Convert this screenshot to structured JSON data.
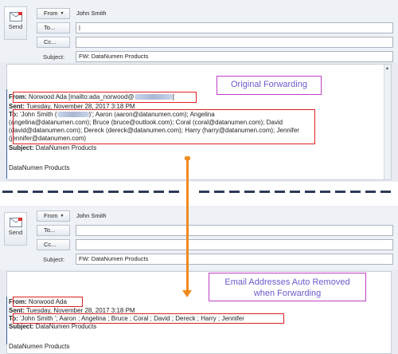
{
  "top": {
    "send_label": "Send",
    "from_label": "From",
    "sender_name": "John Smith",
    "to_label": "To...",
    "cc_label": "Cc...",
    "subject_label": "Subject:",
    "subject_value": "FW: DataNumen Products",
    "from_line_label": "From:",
    "from_line_value": "Norwood Ada [mailto:ada_norwood@",
    "from_line_tail": "]",
    "sent_label": "Sent:",
    "sent_value": "Tuesday, November 28, 2017 3:18 PM",
    "to_line_label": "To:",
    "to_line_1a": "'John Smith (",
    "to_line_1b": ")'; Aaron (aaron@datanumen.com); Angelina",
    "to_line_2": "(angelina@datanumen.com); Bruce (bruce@outlook.com); Coral (coral@datanumen.com); David",
    "to_line_3": "(david@datanumen.com); Dereck (dereck@datanumen.com); Harry (harry@datanumen.com); Jennifer",
    "to_line_4": "(jennifer@datanumen.com)",
    "subject_line_label": "Subject:",
    "subject_line_value": "DataNumen Products",
    "body_text": "DataNumen Products",
    "callout": "Original Forwarding"
  },
  "bottom": {
    "send_label": "Send",
    "from_label": "From",
    "sender_name": "John Smith",
    "to_label": "To...",
    "cc_label": "Cc...",
    "subject_label": "Subject:",
    "subject_value": "FW: DataNumen Products",
    "from_line_label": "From:",
    "from_line_value": "Norwood Ada",
    "sent_label": "Sent:",
    "sent_value": "Tuesday, November 28, 2017 3:18 PM",
    "to_line_label": "To:",
    "to_line_value": "'John Smith '; Aaron ; Angelina ; Bruce ; Coral ; David ; Dereck ; Harry ; Jennifer",
    "subject_line_label": "Subject:",
    "subject_line_value": "DataNumen Products",
    "body_text": "DataNumen Products",
    "callout_line1": "Email Addresses Auto Removed",
    "callout_line2": "when Forwarding"
  },
  "colors": {
    "highlight_box": "#e02020",
    "callout_border": "#c040c8",
    "callout_text": "#6a5acd",
    "arrow": "#f08a1e",
    "separator": "#2c3a56"
  },
  "icons": [
    "send-envelope-icon",
    "dropdown-caret-icon",
    "scroll-up-icon",
    "down-arrow-icon"
  ]
}
